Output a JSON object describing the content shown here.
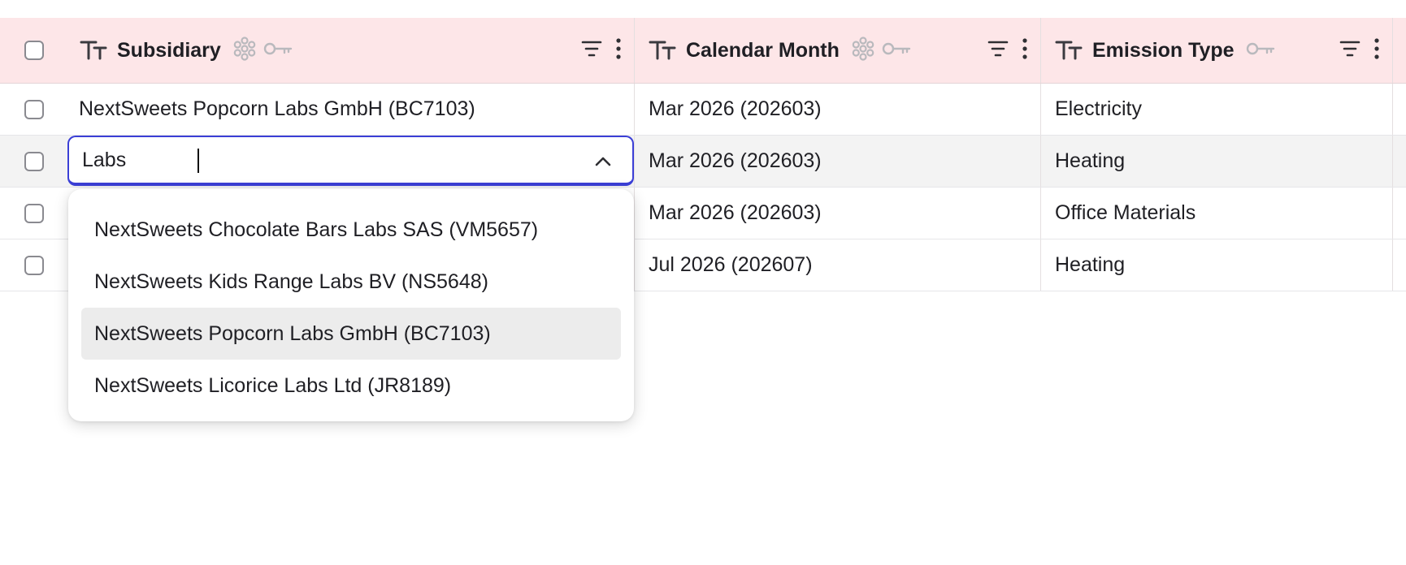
{
  "columns": [
    {
      "title": "Subsidiary",
      "type_icon": "text-type-icon",
      "has_snowflake": true,
      "has_key": true
    },
    {
      "title": "Calendar Month",
      "type_icon": "text-type-icon",
      "has_snowflake": true,
      "has_key": true
    },
    {
      "title": "Emission Type",
      "type_icon": "text-type-icon",
      "has_snowflake": false,
      "has_key": true
    }
  ],
  "rows": [
    {
      "subsidiary": "NextSweets Popcorn Labs GmbH (BC7103)",
      "month": "Mar 2026 (202603)",
      "type": "Electricity"
    },
    {
      "subsidiary": "",
      "month": "Mar 2026 (202603)",
      "type": "Heating"
    },
    {
      "subsidiary": "",
      "month": "Mar 2026 (202603)",
      "type": "Office Materials"
    },
    {
      "subsidiary": "",
      "month": "Jul 2026 (202607)",
      "type": "Heating"
    }
  ],
  "editor": {
    "value": "Labs",
    "options": [
      "NextSweets Chocolate Bars Labs SAS (VM5657)",
      "NextSweets Kids Range Labs BV (NS5648)",
      "NextSweets Popcorn Labs GmbH (BC7103)",
      "NextSweets Licorice Labs Ltd (JR8189)"
    ],
    "highlighted_index": 2
  },
  "colors": {
    "header_bg": "#fde6e8",
    "accent": "#3b3fd6",
    "active_row_bg": "#f3f3f3",
    "highlight_option_bg": "#ececec"
  }
}
